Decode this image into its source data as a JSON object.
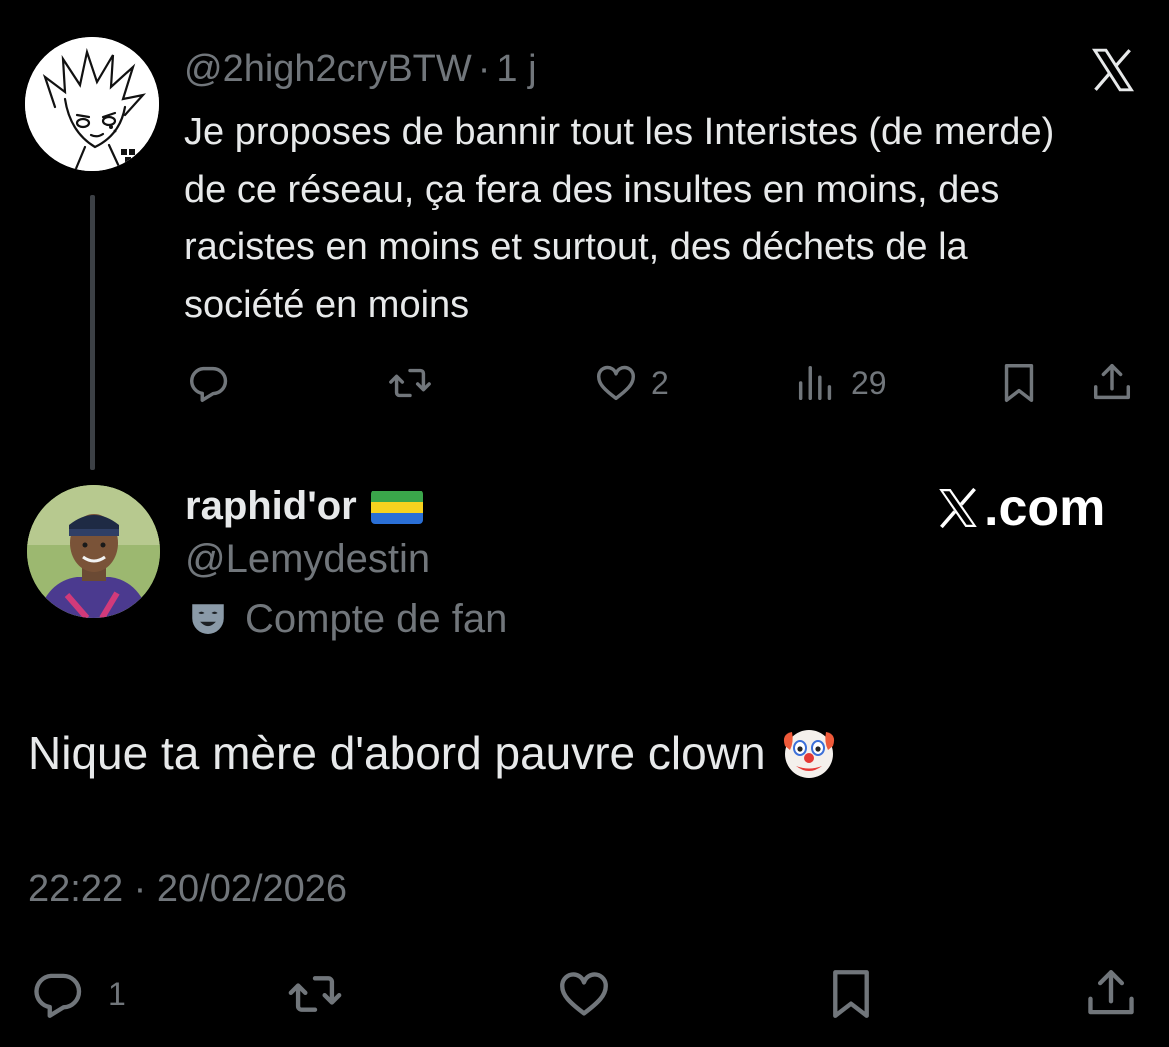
{
  "colors": {
    "background": "#000000",
    "primary_text": "#e7e9ea",
    "secondary_text": "#71767b",
    "thread_line": "#3c4045"
  },
  "parent_tweet": {
    "handle": "@2high2cryBTW",
    "separator": "·",
    "age": "1 j",
    "text": "Je proposes de bannir tout les Interistes (de merde) de ce réseau, ça fera des insultes en moins, des racistes en moins et surtout, des déchets de la société en moins",
    "actions": {
      "reply_icon": "reply-icon",
      "retweet_icon": "retweet-icon",
      "like_icon": "like-icon",
      "like_count": "2",
      "views_icon": "views-icon",
      "views_count": "29",
      "bookmark_icon": "bookmark-icon",
      "share_icon": "share-icon"
    }
  },
  "watermark": {
    "logo_icon": "x-logo-icon",
    "text": ".com"
  },
  "main_tweet": {
    "author_name": "raphid'or",
    "flag_icon": "gabon-flag-icon",
    "author_handle": "@Lemydestin",
    "badge_icon": "theater-mask-icon",
    "badge_text": "Compte de fan",
    "text": "Nique ta mère d'abord pauvre clown",
    "emoji_icon": "clown-face-icon",
    "timestamp": "22:22 · 20/02/2026",
    "actions": {
      "reply_count": "1"
    }
  }
}
